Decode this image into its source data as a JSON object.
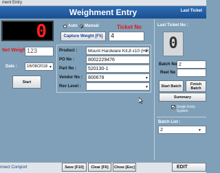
{
  "window": {
    "title": "ment Entry"
  },
  "header": {
    "title": "Weighment Entry",
    "last_ticket_short": "Last Ticket"
  },
  "weight_display": {
    "value": "0"
  },
  "mode": {
    "auto_label": "Auto",
    "manual_label": "Manual",
    "selected": "manual"
  },
  "capture_button": "Capture Weight [F5]",
  "ticket": {
    "label": "Ticket No",
    "value": "4"
  },
  "net_weight": {
    "label": "Net Weight :",
    "value": "123"
  },
  "date": {
    "label": "Date :",
    "value": "16/08/2018"
  },
  "start_button": "Start",
  "product": {
    "label": "Product :",
    "value": "Mount Hardware Kit,8 x10  (HP,"
  },
  "po_no": {
    "label": "PO No :",
    "value": "8002229476"
  },
  "part_no": {
    "label": "Part No :",
    "value": "520130-1"
  },
  "vendor_no": {
    "label": "Vendor No :",
    "value": "800678"
  },
  "rev_level": {
    "label": "Rev Level :",
    "value": ""
  },
  "right_panel": {
    "last_ticket_label": "Last Ticket No :",
    "last_ticket_value": "0",
    "batch_no_label": "Batch No :",
    "batch_no_value": "2",
    "reel_no_label": "Reel No :",
    "reel_no_value": "",
    "start_batch": "Start Batch",
    "finish_batch": "Finish Batch",
    "summary": "Summary",
    "single_entry_label": "Single Entry System",
    "single_entry_checked": true,
    "batch_list_label": "Batch List :",
    "batch_list_value": "2"
  },
  "footer": {
    "status": "nnect Comport",
    "save": "Save [F10]",
    "clear": "Clear [F6]",
    "close": "Close [Esc]",
    "edit": "EDIT"
  },
  "colors": {
    "header_blue": "#1f5aa2",
    "display_red": "#ff2020",
    "label_red": "#e01818",
    "background": "#7fa0b8"
  }
}
